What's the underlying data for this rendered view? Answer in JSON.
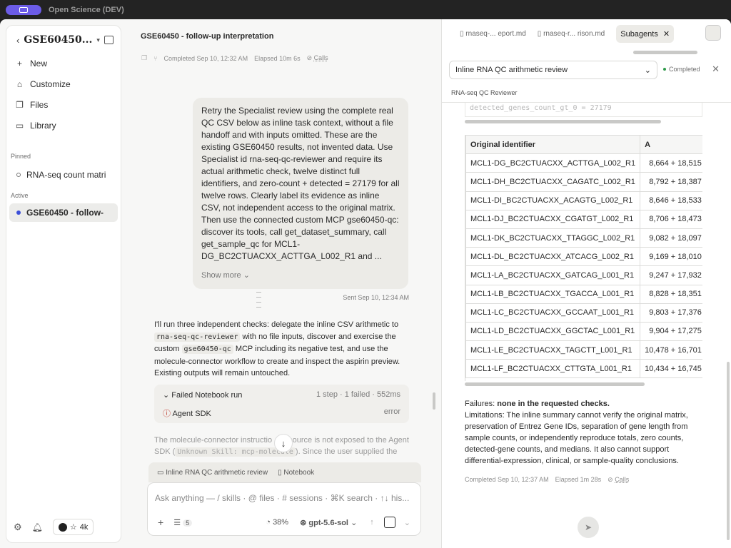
{
  "app": {
    "title": "Open Science (DEV)"
  },
  "sidebar": {
    "project_title": "GSE60450...",
    "nav": [
      {
        "label": "New",
        "icon": "+"
      },
      {
        "label": "Customize",
        "icon": "⌂"
      },
      {
        "label": "Files",
        "icon": "❐"
      },
      {
        "label": "Library",
        "icon": "▭"
      }
    ],
    "pinned_label": "Pinned",
    "pinned": [
      {
        "label": "RNA-seq count matri"
      }
    ],
    "active_label": "Active",
    "active": [
      {
        "label": "GSE60450 - follow-"
      }
    ],
    "github_stars": "4k"
  },
  "chat": {
    "title": "GSE60450 - follow-up interpretation",
    "completed": "Completed Sep 10, 12:32 AM",
    "elapsed": "Elapsed 10m 6s",
    "calls": "Calls",
    "user_message": "Retry the Specialist review using the complete real QC CSV below as inline task context, without a file handoff and with inputs omitted. These are the existing GSE60450 results, not invented data. Use Specialist id rna-seq-qc-reviewer and require its actual arithmetic check, twelve distinct full identifiers, and zero-count + detected = 27179 for all twelve rows. Clearly label its evidence as inline CSV, not independent access to the original matrix. Then use the connected custom MCP gse60450-qc: discover its tools, call get_dataset_summary, call get_sample_qc for MCL1-DG_BC2CTUACXX_ACTTGA_L002_R1 and ...",
    "show_more": "Show more",
    "sent": "Sent Sep 10, 12:34 AM",
    "answer": {
      "p1": "I'll run three independent checks: delegate the inline CSV arithmetic to",
      "code1": "rna-seq-qc-reviewer",
      "p2": "with no file inputs, discover and exercise the custom",
      "code2": "gse60450-qc",
      "p3": "MCP including its negative test, and use the molecule-connector workflow to create and inspect the aspirin preview. Existing outputs will remain untouched."
    },
    "run": {
      "title": "Failed Notebook run",
      "stats": "1 step · 1 failed · 552ms",
      "step": "Agent SDK",
      "step_status": "error"
    },
    "faded": {
      "p1": "The molecule-connector instructio",
      "p1b": "source is not exposed to the Agent SDK (",
      "code": "Unknown Skill: mcp-molecule",
      "p2": "). Since the user supplied the"
    },
    "composer": {
      "tab1": "Inline RNA QC arithmetic review",
      "tab2": "Notebook",
      "placeholder": "Ask anything — / skills · @ files · # sessions · ⌘K search · ↑↓ his...",
      "tools_count": "5",
      "context": "38%",
      "model": "gpt-5.6-sol"
    }
  },
  "right": {
    "tabs": [
      "rnaseq-... eport.md",
      "rnaseq-r... rison.md"
    ],
    "active_tab": "Subagents",
    "review_select": "Inline RNA QC arithmetic review",
    "status": "Completed",
    "subagent_label": "RNA-seq QC Reviewer",
    "faded_row": "detected_genes_count_gt_0 = 27179",
    "table": {
      "headers": [
        "Original identifier",
        "A"
      ],
      "rows": [
        [
          "MCL1-DG_BC2CTUACXX_ACTTGA_L002_R1",
          "8,664 + 18,515"
        ],
        [
          "MCL1-DH_BC2CTUACXX_CAGATC_L002_R1",
          "8,792 + 18,387"
        ],
        [
          "MCL1-DI_BC2CTUACXX_ACAGTG_L002_R1",
          "8,646 + 18,533"
        ],
        [
          "MCL1-DJ_BC2CTUACXX_CGATGT_L002_R1",
          "8,706 + 18,473"
        ],
        [
          "MCL1-DK_BC2CTUACXX_TTAGGC_L002_R1",
          "9,082 + 18,097"
        ],
        [
          "MCL1-DL_BC2CTUACXX_ATCACG_L002_R1",
          "9,169 + 18,010"
        ],
        [
          "MCL1-LA_BC2CTUACXX_GATCAG_L001_R1",
          "9,247 + 17,932"
        ],
        [
          "MCL1-LB_BC2CTUACXX_TGACCA_L001_R1",
          "8,828 + 18,351"
        ],
        [
          "MCL1-LC_BC2CTUACXX_GCCAAT_L001_R1",
          "9,803 + 17,376"
        ],
        [
          "MCL1-LD_BC2CTUACXX_GGCTAC_L001_R1",
          "9,904 + 17,275"
        ],
        [
          "MCL1-LE_BC2CTUACXX_TAGCTT_L001_R1",
          "10,478 + 16,701"
        ],
        [
          "MCL1-LF_BC2CTUACXX_CTTGTA_L001_R1",
          "10,434 + 16,745"
        ]
      ]
    },
    "failures_label": "Failures:",
    "failures_value": "none in the requested checks.",
    "limitations": "Limitations: The inline summary cannot verify the original matrix, preservation of Entrez Gene IDs, separation of gene length from sample counts, or independently reproduce totals, zero counts, detected-gene counts, and medians. It also cannot support differential-expression, clinical, or sample-quality conclusions.",
    "completed": "Completed Sep 10, 12:37 AM",
    "elapsed": "Elapsed 1m 28s",
    "calls": "Calls"
  }
}
